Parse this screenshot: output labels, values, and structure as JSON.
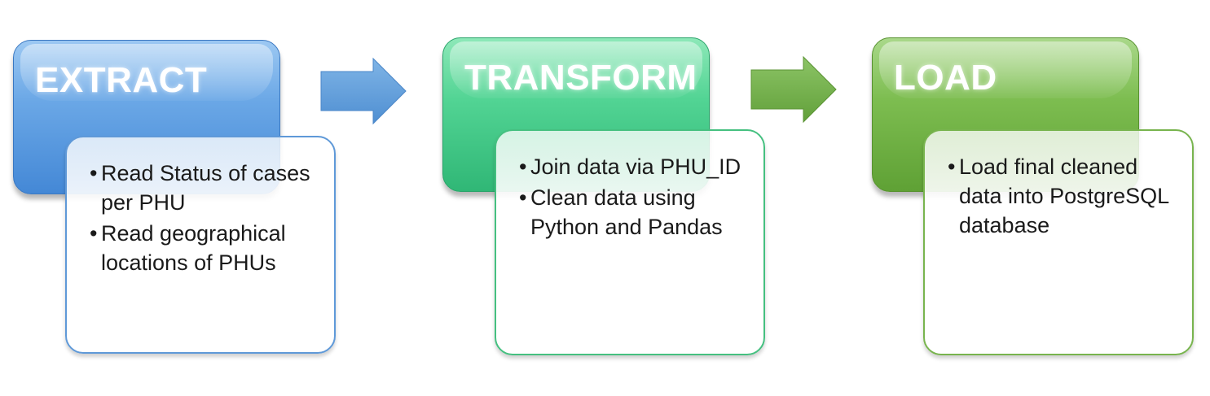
{
  "stages": [
    {
      "title": "EXTRACT",
      "bullets": [
        "Read Status of cases per PHU",
        "Read geographical locations of PHUs"
      ]
    },
    {
      "title": "TRANSFORM",
      "bullets": [
        "Join data via PHU_ID",
        "Clean data using Python and Pandas"
      ]
    },
    {
      "title": "LOAD",
      "bullets": [
        "Load final cleaned data into PostgreSQL database"
      ]
    }
  ],
  "colors": {
    "extract": "#5b9bd5",
    "transform": "#3fcc88",
    "load": "#70ad47",
    "arrow_blue": "#5b9bd5",
    "arrow_green": "#70ad47"
  }
}
